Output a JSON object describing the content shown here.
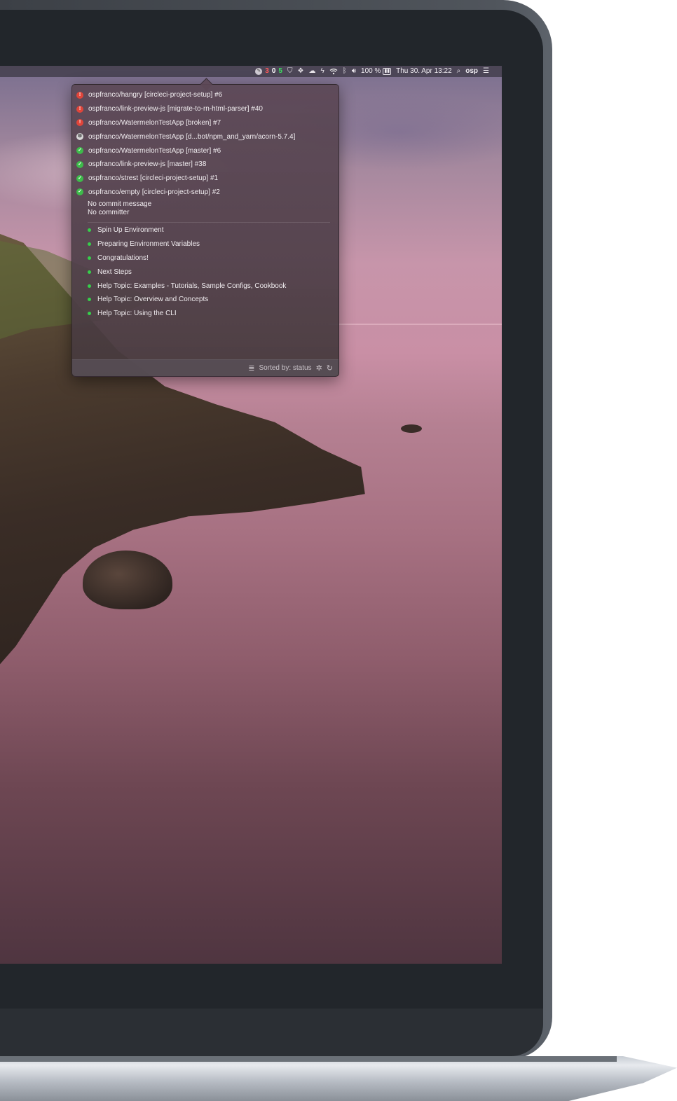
{
  "menubar": {
    "pencil_icon": "pencil-circle-icon",
    "count_failed": "3",
    "count_running": "0",
    "count_success": "5",
    "icons": [
      "shield-icon",
      "dropbox-icon",
      "cloud-icon",
      "lightning-icon",
      "wifi-icon",
      "bluetooth-icon",
      "volume-icon"
    ],
    "battery_percent": "100 %",
    "datetime": "Thu 30. Apr  13:22",
    "user": "osp",
    "colors": {
      "failed": "#ff5a5a",
      "running": "#ffffff",
      "success": "#3ddc61"
    }
  },
  "popover": {
    "builds": [
      {
        "label": "ospfranco/hangry [circleci-project-setup] #6",
        "status": "failed"
      },
      {
        "label": "ospfranco/link-preview-js [migrate-to-rn-html-parser] #40",
        "status": "failed"
      },
      {
        "label": "ospfranco/WatermelonTestApp [broken] #7",
        "status": "failed"
      },
      {
        "label": "ospfranco/WatermelonTestApp [d...bot/npm_and_yarn/acorn-5.7.4]",
        "status": "running"
      },
      {
        "label": "ospfranco/WatermelonTestApp [master] #6",
        "status": "success"
      },
      {
        "label": "ospfranco/link-preview-js [master] #38",
        "status": "success"
      },
      {
        "label": "ospfranco/strest [circleci-project-setup] #1",
        "status": "success"
      },
      {
        "label": "ospfranco/empty [circleci-project-setup] #2",
        "status": "success"
      }
    ],
    "detail": {
      "commit_message": "No commit message",
      "committer": "No committer"
    },
    "steps": [
      "Spin Up Environment",
      "Preparing Environment Variables",
      "Congratulations!",
      "Next Steps",
      "Help Topic: Examples - Tutorials, Sample Configs, Cookbook",
      "Help Topic: Overview and Concepts",
      "Help Topic: Using the CLI"
    ],
    "footer": {
      "sort_label": "Sorted by: status",
      "sort_icon": "sort-lines-icon",
      "settings_icon": "gear-icon",
      "refresh_icon": "refresh-icon"
    }
  }
}
